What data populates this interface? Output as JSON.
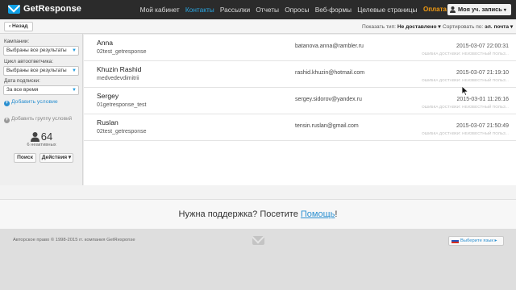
{
  "header": {
    "logo_text": "GetResponse",
    "nav": [
      "Мой кабинет",
      "Контакты",
      "Рассылки",
      "Отчеты",
      "Опросы",
      "Веб-формы",
      "Целевые страницы"
    ],
    "active_nav": "Контакты",
    "payment_label": "Оплата",
    "account_label": "Моя уч. запись",
    "accent": "#2aa9e6"
  },
  "toolbar": {
    "back_label": "‹ Назад",
    "show_type_label": "Показать тип:",
    "show_type_value": "Не доставлено ▾",
    "sort_label": "Сортировать по:",
    "sort_value": "эл. почта ▾"
  },
  "filters": {
    "campaigns_label": "Кампании:",
    "campaigns_value": "Выбраны все результаты",
    "autoresponder_label": "Цикл автоответчика:",
    "autoresponder_value": "Выбраны все результаты",
    "subscription_date_label": "Дата подписки:",
    "subscription_date_value": "За все время",
    "add_condition_label": "Добавить условие",
    "add_group_label": "Добавить группу условий",
    "count": "64",
    "inactive_label": "6 неактивных",
    "search_button": "Поиск",
    "actions_button": "Действия ▾"
  },
  "contacts": [
    {
      "name": "Anna",
      "campaign": "02test_getresponse",
      "email": "batanova.anna@rambler.ru",
      "date": "2015-03-07 22:00:31",
      "status": "ОШИБКА ДОСТАВКИ: НЕИЗВЕСТНЫЙ ПОЛЬЗ..."
    },
    {
      "name": "Khuzin Rashid",
      "campaign": "medvedevdimitrii",
      "email": "rashid.khuzin@hotmail.com",
      "date": "2015-03-07 21:19:10",
      "status": "ОШИБКА ДОСТАВКИ: НЕИЗВЕСТНЫЙ ПОЛЬЗ..."
    },
    {
      "name": "Sergey",
      "campaign": "01getresponse_test",
      "email": "sergey.sidorov@yandex.ru",
      "date": "2015-03-01 11:26:16",
      "status": "ОШИБКА ДОСТАВКИ: НЕИЗВЕСТНЫЙ ПОЛЬЗ..."
    },
    {
      "name": "Ruslan",
      "campaign": "02test_getresponse",
      "email": "tensin.ruslan@gmail.com",
      "date": "2015-03-07 21:50:49",
      "status": "ОШИБКА ДОСТАВКИ: НЕИЗВЕСТНЫЙ ПОЛЬЗ..."
    }
  ],
  "support": {
    "text_before": "Нужна поддержка? Посетите ",
    "link": "Помощь",
    "text_after": "!"
  },
  "footer": {
    "copyright": "Авторское право © 1998-2015 гг. компания GetResponse",
    "language_button": "Выберите язык ▸"
  }
}
